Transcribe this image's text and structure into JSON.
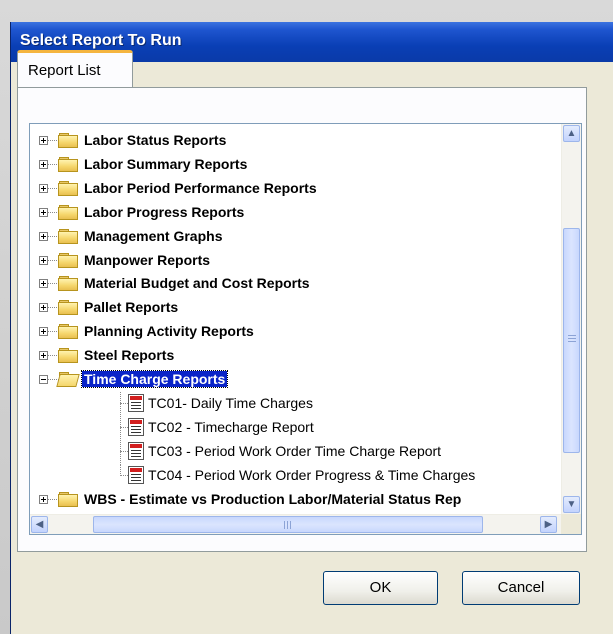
{
  "dialog": {
    "title": "Select Report To Run",
    "tab_label": "Report List",
    "ok_label": "OK",
    "cancel_label": "Cancel"
  },
  "tree": {
    "folders_before": [
      "Labor  Status Reports",
      "Labor  Summary Reports",
      "Labor Period Performance Reports",
      "Labor Progress Reports",
      "Management Graphs",
      "Manpower Reports",
      "Material Budget and Cost Reports",
      "Pallet Reports",
      "Planning Activity Reports",
      "Steel Reports"
    ],
    "expanded_folder": "Time Charge Reports",
    "children": [
      "TC01- Daily Time Charges",
      "TC02 - Timecharge Report",
      "TC03 - Period Work Order Time Charge Report",
      "TC04 - Period Work Order Progress & Time Charges"
    ],
    "folders_after": [
      "WBS - Estimate vs Production Labor/Material Status Rep"
    ]
  },
  "icons": {
    "folder": "folder-icon",
    "open_folder": "open-folder-icon",
    "report": "report-icon",
    "expand": "plus-expander-icon",
    "collapse": "minus-expander-icon"
  },
  "colors": {
    "title_bar": "#0a3fb5",
    "selection": "#0a24c8",
    "dialog_bg": "#ece9d8"
  }
}
